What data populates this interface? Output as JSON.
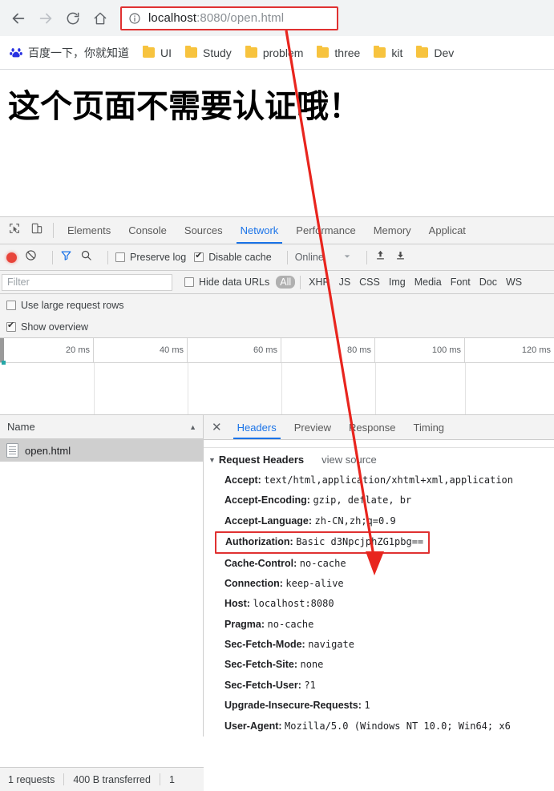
{
  "browser": {
    "nav": {
      "back_icon": "arrow-left-icon",
      "forward_icon": "arrow-right-icon",
      "reload_icon": "reload-icon",
      "home_icon": "home-icon"
    },
    "omnibox": {
      "info_icon": "info-circle-icon",
      "host": "localhost",
      "path": ":8080/open.html",
      "full_url": "localhost:8080/open.html",
      "highlight_color": "#e03131"
    },
    "bookmarks": [
      {
        "label": "百度一下，你就知道",
        "icon": "baidu-icon"
      },
      {
        "label": "UI",
        "icon": "folder-icon"
      },
      {
        "label": "Study",
        "icon": "folder-icon"
      },
      {
        "label": "problem",
        "icon": "folder-icon"
      },
      {
        "label": "three",
        "icon": "folder-icon"
      },
      {
        "label": "kit",
        "icon": "folder-icon"
      },
      {
        "label": "Dev",
        "icon": "folder-icon"
      }
    ]
  },
  "page": {
    "heading": "这个页面不需要认证哦！"
  },
  "devtools": {
    "icons": {
      "inspect": "inspect-element-icon",
      "device": "device-toolbar-icon"
    },
    "tabs": [
      {
        "label": "Elements",
        "active": false
      },
      {
        "label": "Console",
        "active": false
      },
      {
        "label": "Sources",
        "active": false
      },
      {
        "label": "Network",
        "active": true
      },
      {
        "label": "Performance",
        "active": false
      },
      {
        "label": "Memory",
        "active": false
      },
      {
        "label": "Applicat",
        "active": false
      }
    ],
    "accent_color": "#1a73e8",
    "toolbar": {
      "record_icon": "record-button-icon",
      "clear_icon": "clear-icon",
      "filter_icon": "filter-funnel-icon",
      "search_icon": "search-icon",
      "preserve_log": {
        "label": "Preserve log",
        "checked": false
      },
      "disable_cache": {
        "label": "Disable cache",
        "checked": true
      },
      "throttling": {
        "label": "Online",
        "caret_icon": "chevron-down-icon"
      },
      "import_icon": "import-har-icon",
      "export_icon": "export-har-icon"
    },
    "filterbar": {
      "filter_placeholder": "Filter",
      "hide_data_urls": {
        "label": "Hide data URLs",
        "checked": false
      },
      "types": [
        {
          "label": "All",
          "selected": true
        },
        {
          "label": "XHR",
          "selected": false
        },
        {
          "label": "JS",
          "selected": false
        },
        {
          "label": "CSS",
          "selected": false
        },
        {
          "label": "Img",
          "selected": false
        },
        {
          "label": "Media",
          "selected": false
        },
        {
          "label": "Font",
          "selected": false
        },
        {
          "label": "Doc",
          "selected": false
        },
        {
          "label": "WS",
          "selected": false
        }
      ]
    },
    "options": {
      "use_large_rows": {
        "label": "Use large request rows",
        "checked": false
      },
      "show_overview": {
        "label": "Show overview",
        "checked": true
      }
    },
    "overview": {
      "ticks": [
        "20 ms",
        "40 ms",
        "60 ms",
        "80 ms",
        "100 ms",
        "120 ms"
      ]
    },
    "requests": {
      "column_header": "Name",
      "sort_icon": "sort-ascending-icon",
      "rows": [
        {
          "name": "open.html",
          "icon": "document-icon",
          "selected": true
        }
      ]
    },
    "detail": {
      "close_icon": "close-icon",
      "tabs": [
        {
          "label": "Headers",
          "active": true
        },
        {
          "label": "Preview",
          "active": false
        },
        {
          "label": "Response",
          "active": false
        },
        {
          "label": "Timing",
          "active": false
        }
      ],
      "section": {
        "toggle_icon": "triangle-down-icon",
        "title": "Request Headers",
        "view_source": "view source"
      },
      "headers": [
        {
          "name": "Accept:",
          "value": "text/html,application/xhtml+xml,application",
          "highlighted": false
        },
        {
          "name": "Accept-Encoding:",
          "value": "gzip, deflate, br",
          "highlighted": false
        },
        {
          "name": "Accept-Language:",
          "value": "zh-CN,zh;q=0.9",
          "highlighted": false
        },
        {
          "name": "Authorization:",
          "value": "Basic d3NpcjphZG1pbg==",
          "highlighted": true
        },
        {
          "name": "Cache-Control:",
          "value": "no-cache",
          "highlighted": false
        },
        {
          "name": "Connection:",
          "value": "keep-alive",
          "highlighted": false
        },
        {
          "name": "Host:",
          "value": "localhost:8080",
          "highlighted": false
        },
        {
          "name": "Pragma:",
          "value": "no-cache",
          "highlighted": false
        },
        {
          "name": "Sec-Fetch-Mode:",
          "value": "navigate",
          "highlighted": false
        },
        {
          "name": "Sec-Fetch-Site:",
          "value": "none",
          "highlighted": false
        },
        {
          "name": "Sec-Fetch-User:",
          "value": "?1",
          "highlighted": false
        },
        {
          "name": "Upgrade-Insecure-Requests:",
          "value": "1",
          "highlighted": false
        },
        {
          "name": "User-Agent:",
          "value": "Mozilla/5.0 (Windows NT 10.0; Win64; x6",
          "highlighted": false
        }
      ]
    },
    "status": {
      "requests": "1 requests",
      "transferred": "400 B transferred",
      "extra": "1"
    }
  },
  "annotation": {
    "arrow_color": "#e8251e",
    "description": "red-arrow-from-url-to-authorization-header"
  }
}
